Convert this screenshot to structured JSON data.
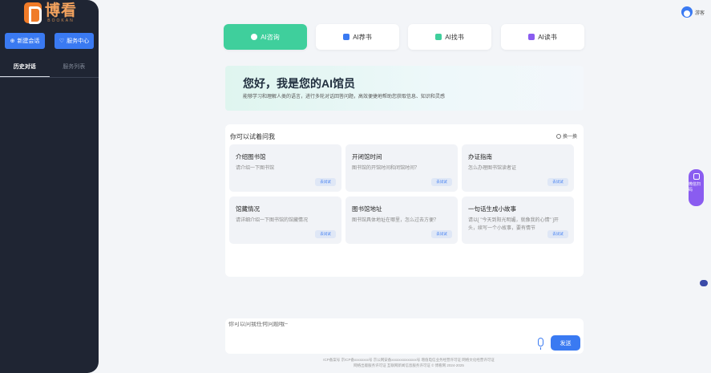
{
  "brand": {
    "title": "博看",
    "subtitle": "BOOKAN",
    "color": "#f07b28"
  },
  "sidebar": {
    "new_chat": "新建会话",
    "service": "服务中心",
    "tabs": [
      {
        "label": "历史对话",
        "active": true
      },
      {
        "label": "服务列表",
        "active": false
      }
    ]
  },
  "user": {
    "name": "游客"
  },
  "modes": [
    {
      "label": "AI咨询",
      "icon": "chat-icon",
      "active": true,
      "color": "#3fcf9c"
    },
    {
      "label": "AI荐书",
      "icon": "thumb-icon",
      "active": false,
      "color": "#3a7af2"
    },
    {
      "label": "AI找书",
      "icon": "book-search-icon",
      "active": false,
      "color": "#3fcf9c"
    },
    {
      "label": "AI读书",
      "icon": "read-icon",
      "active": false,
      "color": "#8a5cf0"
    }
  ],
  "banner": {
    "title": "您好，我是您的AI馆员",
    "subtitle": "能够学习和理解人类的语言，进行多轮对话回答问题，高效便捷地帮助您获取信息、知识和灵感"
  },
  "suggestions": {
    "title": "你可以试着问我",
    "refresh": "换一换",
    "try_label": "去试试",
    "cards": [
      {
        "title": "介绍图书馆",
        "desc": "请介绍一下图书馆"
      },
      {
        "title": "开闭馆时间",
        "desc": "图书馆的开馆时间和闭馆时间？"
      },
      {
        "title": "办证指南",
        "desc": "怎么办理图书馆读者证"
      },
      {
        "title": "馆藏情况",
        "desc": "请详细介绍一下图书馆的馆藏情况"
      },
      {
        "title": "图书馆地址",
        "desc": "图书馆具体地址在哪里，怎么过去方便？"
      },
      {
        "title": "一句话生成小故事",
        "desc": "请以[ \"今天到阳光明媚，就像我的心情\" ]开头，续写一个小故事，要有情节"
      }
    ]
  },
  "input": {
    "placeholder": "你可以问我任何问题哦~",
    "send": "发送"
  },
  "float": {
    "label": "微信扫码"
  },
  "footer": {
    "line1": "ICP备案号 京ICP备xxxxxxxx号  京公网安备xxxxxxxxxxxxxx号  增值电信业务经营许可证  网络文化经营许可证",
    "line2": "网络出版服务许可证  互联网新闻信息服务许可证  © 博看网 2024-2025"
  }
}
